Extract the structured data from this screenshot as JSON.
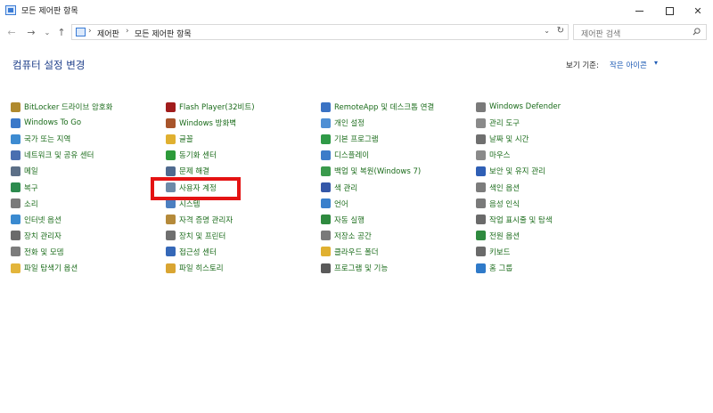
{
  "window": {
    "title": "모든 제어판 항목",
    "minimize_label": "",
    "maximize_label": "",
    "close_label": "✕"
  },
  "nav": {
    "back_glyph": "←",
    "forward_glyph": "→",
    "recent_glyph": "⌄",
    "up_glyph": "↑"
  },
  "address": {
    "crumbs": [
      "제어판",
      "모든 제어판 항목"
    ],
    "separator": "›",
    "dropdown_glyph": "⌄",
    "refresh_glyph": "↻"
  },
  "search": {
    "placeholder": "제어판 검색"
  },
  "header": {
    "title": "컴퓨터 설정 변경",
    "view_by_label": "보기 기준:",
    "view_by_value": "작은 아이콘",
    "view_by_caret": "▾"
  },
  "items": {
    "col1": [
      {
        "label": "BitLocker 드라이브 암호화",
        "icon": "bitlocker-icon",
        "color": "#b08a2e"
      },
      {
        "label": "Windows To Go",
        "icon": "windows-to-go-icon",
        "color": "#3a78c9"
      },
      {
        "label": "국가 또는 지역",
        "icon": "region-icon",
        "color": "#3d8bd1"
      },
      {
        "label": "네트워크 및 공유 센터",
        "icon": "network-icon",
        "color": "#4a6fb0"
      },
      {
        "label": "메일",
        "icon": "mail-icon",
        "color": "#5c6f87"
      },
      {
        "label": "복구",
        "icon": "recovery-icon",
        "color": "#2c8b4e"
      },
      {
        "label": "소리",
        "icon": "sound-icon",
        "color": "#7a7a7a"
      },
      {
        "label": "인터넷 옵션",
        "icon": "internet-options-icon",
        "color": "#3a8ad0"
      },
      {
        "label": "장치 관리자",
        "icon": "device-manager-icon",
        "color": "#6b6b6b"
      },
      {
        "label": "전화 및 모뎀",
        "icon": "phone-modem-icon",
        "color": "#7c7c7c"
      },
      {
        "label": "파일 탐색기 옵션",
        "icon": "folder-options-icon",
        "color": "#e3b53b"
      }
    ],
    "col2": [
      {
        "label": "Flash Player(32비트)",
        "icon": "flash-player-icon",
        "color": "#a11c1c"
      },
      {
        "label": "Windows 방화벽",
        "icon": "firewall-icon",
        "color": "#a8552b"
      },
      {
        "label": "글꼴",
        "icon": "fonts-icon",
        "color": "#e0b030"
      },
      {
        "label": "동기화 센터",
        "icon": "sync-center-icon",
        "color": "#2d9a3a"
      },
      {
        "label": "문제 해결",
        "icon": "troubleshooting-icon",
        "color": "#4f6a8f"
      },
      {
        "label": "사용자 계정",
        "icon": "user-accounts-icon",
        "color": "#6d8aa8"
      },
      {
        "label": "시스템",
        "icon": "system-icon",
        "color": "#4c7fc0"
      },
      {
        "label": "자격 증명 관리자",
        "icon": "credential-manager-icon",
        "color": "#b58a3a"
      },
      {
        "label": "장치 및 프린터",
        "icon": "devices-printers-icon",
        "color": "#6f6f6f"
      },
      {
        "label": "접근성 센터",
        "icon": "ease-of-access-icon",
        "color": "#3568b8"
      },
      {
        "label": "파일 히스토리",
        "icon": "file-history-icon",
        "color": "#d9a532"
      }
    ],
    "col3": [
      {
        "label": "RemoteApp 및 데스크톱 연결",
        "icon": "remoteapp-icon",
        "color": "#3b73c4"
      },
      {
        "label": "개인 설정",
        "icon": "personalization-icon",
        "color": "#4e8fd4"
      },
      {
        "label": "기본 프로그램",
        "icon": "default-programs-icon",
        "color": "#2f9a47"
      },
      {
        "label": "디스플레이",
        "icon": "display-icon",
        "color": "#3c7cc9"
      },
      {
        "label": "백업 및 복원(Windows 7)",
        "icon": "backup-restore-icon",
        "color": "#3a9a4c"
      },
      {
        "label": "색 관리",
        "icon": "color-management-icon",
        "color": "#3558a8"
      },
      {
        "label": "언어",
        "icon": "language-icon",
        "color": "#3a80cc"
      },
      {
        "label": "자동 실행",
        "icon": "autoplay-icon",
        "color": "#2f8a3f"
      },
      {
        "label": "저장소 공간",
        "icon": "storage-spaces-icon",
        "color": "#7a7a7a"
      },
      {
        "label": "클라우드 폴더",
        "icon": "work-folders-icon",
        "color": "#e0b030"
      },
      {
        "label": "프로그램 및 기능",
        "icon": "programs-features-icon",
        "color": "#5a5a5a"
      }
    ],
    "col4": [
      {
        "label": "Windows Defender",
        "icon": "windows-defender-icon",
        "color": "#7a7a7a"
      },
      {
        "label": "관리 도구",
        "icon": "admin-tools-icon",
        "color": "#8a8a8a"
      },
      {
        "label": "날짜 및 시간",
        "icon": "date-time-icon",
        "color": "#6f6f6f"
      },
      {
        "label": "마우스",
        "icon": "mouse-icon",
        "color": "#8a8a8a"
      },
      {
        "label": "보안 및 유지 관리",
        "icon": "security-maintenance-icon",
        "color": "#2f5fb5"
      },
      {
        "label": "색인 옵션",
        "icon": "indexing-options-icon",
        "color": "#7c7c7c"
      },
      {
        "label": "음성 인식",
        "icon": "speech-recognition-icon",
        "color": "#7a7a7a"
      },
      {
        "label": "작업 표시줄 및 탐색",
        "icon": "taskbar-navigation-icon",
        "color": "#6a6a6a"
      },
      {
        "label": "전원 옵션",
        "icon": "power-options-icon",
        "color": "#2f8a3f"
      },
      {
        "label": "키보드",
        "icon": "keyboard-icon",
        "color": "#6a6a6a"
      },
      {
        "label": "홈 그룹",
        "icon": "homegroup-icon",
        "color": "#2f7ac9"
      }
    ]
  },
  "annotation": {
    "highlight_color": "#e41313"
  }
}
